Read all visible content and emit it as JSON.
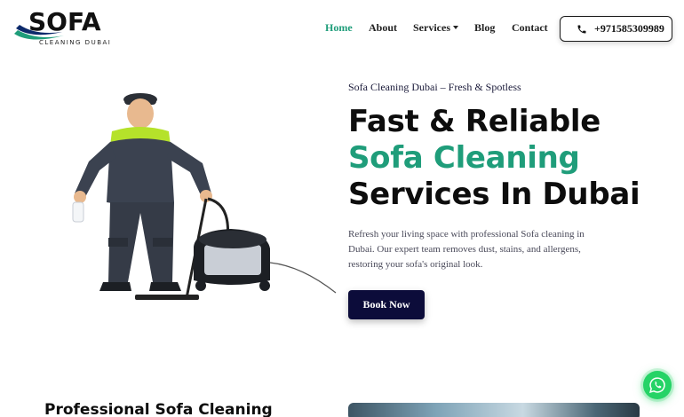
{
  "brand": {
    "wordmark": "SOFA",
    "tagline": "CLEANING DUBAI",
    "accent_color": "#1f9d7a",
    "navy_color": "#0c0c3a"
  },
  "nav": {
    "items": [
      {
        "label": "Home",
        "active": true
      },
      {
        "label": "About"
      },
      {
        "label": "Services",
        "has_dropdown": true
      },
      {
        "label": "Blog"
      },
      {
        "label": "Contact"
      }
    ]
  },
  "header": {
    "phone": "+971585309989",
    "phone_icon": "phone-icon"
  },
  "hero": {
    "subtitle": "Sofa Cleaning Dubai – Fresh & Spotless",
    "headline_line1": "Fast & Reliable",
    "headline_line2": "Sofa Cleaning",
    "headline_line3": "Services In Dubai",
    "description": "Refresh your living space with professional Sofa cleaning in Dubai. Our expert team removes dust, stains, and allergens, restoring your sofa's original look.",
    "cta": "Book Now"
  },
  "section": {
    "title": "Professional Sofa Cleaning"
  },
  "floating": {
    "whatsapp_icon": "whatsapp-icon",
    "whatsapp_color": "#25d366"
  }
}
